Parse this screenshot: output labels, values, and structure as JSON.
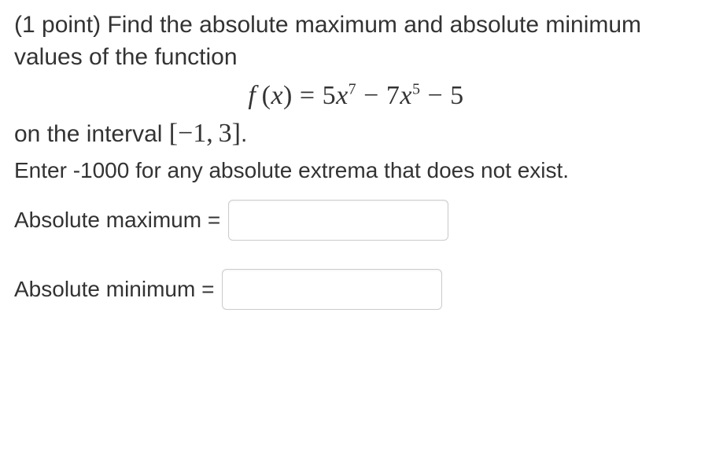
{
  "question": {
    "points_prefix": "(1 point) ",
    "prompt_part1": "Find the absolute maximum and absolute minimum values of the function",
    "function_display": "f (x) = 5x⁷ − 7x⁵ − 5",
    "interval_prefix": "on the interval ",
    "interval_display": "[−1, 3]",
    "interval_suffix": ".",
    "hint": "Enter -1000 for any absolute extrema that does not exist."
  },
  "answers": {
    "max_label": "Absolute maximum = ",
    "max_value": "",
    "min_label": "Absolute minimum = ",
    "min_value": ""
  }
}
